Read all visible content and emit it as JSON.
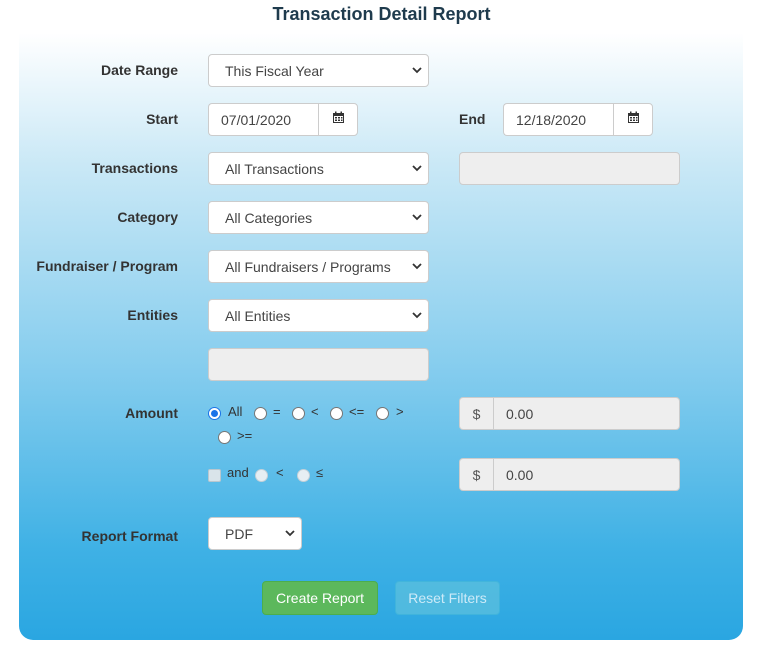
{
  "page": {
    "title": "Transaction Detail Report"
  },
  "form": {
    "date_range": {
      "label": "Date Range",
      "value": "This Fiscal Year"
    },
    "start": {
      "label": "Start",
      "value": "07/01/2020"
    },
    "end": {
      "label": "End",
      "value": "12/18/2020"
    },
    "transactions": {
      "label": "Transactions",
      "value": "All Transactions"
    },
    "category": {
      "label": "Category",
      "value": "All Categories"
    },
    "fundraiser": {
      "label": "Fundraiser / Program",
      "value": "All Fundraisers / Programs"
    },
    "entities": {
      "label": "Entities",
      "value": "All Entities"
    },
    "amount": {
      "label": "Amount",
      "options": [
        "All",
        "=",
        "<",
        "<=",
        ">",
        ">="
      ],
      "selected": "All",
      "currency": "$",
      "value1": "0.00",
      "and_label": "and",
      "and_options": [
        "<",
        "≤"
      ],
      "value2": "0.00"
    },
    "report_format": {
      "label": "Report Format",
      "value": "PDF"
    }
  },
  "actions": {
    "create": "Create Report",
    "reset": "Reset Filters"
  },
  "icons": {
    "calendar": "calendar-icon",
    "dropdown": "chevron-down-icon"
  },
  "colors": {
    "primary_button": "#5cb85c",
    "secondary_button": "#5bc0de",
    "accent": "#1a73e8"
  }
}
